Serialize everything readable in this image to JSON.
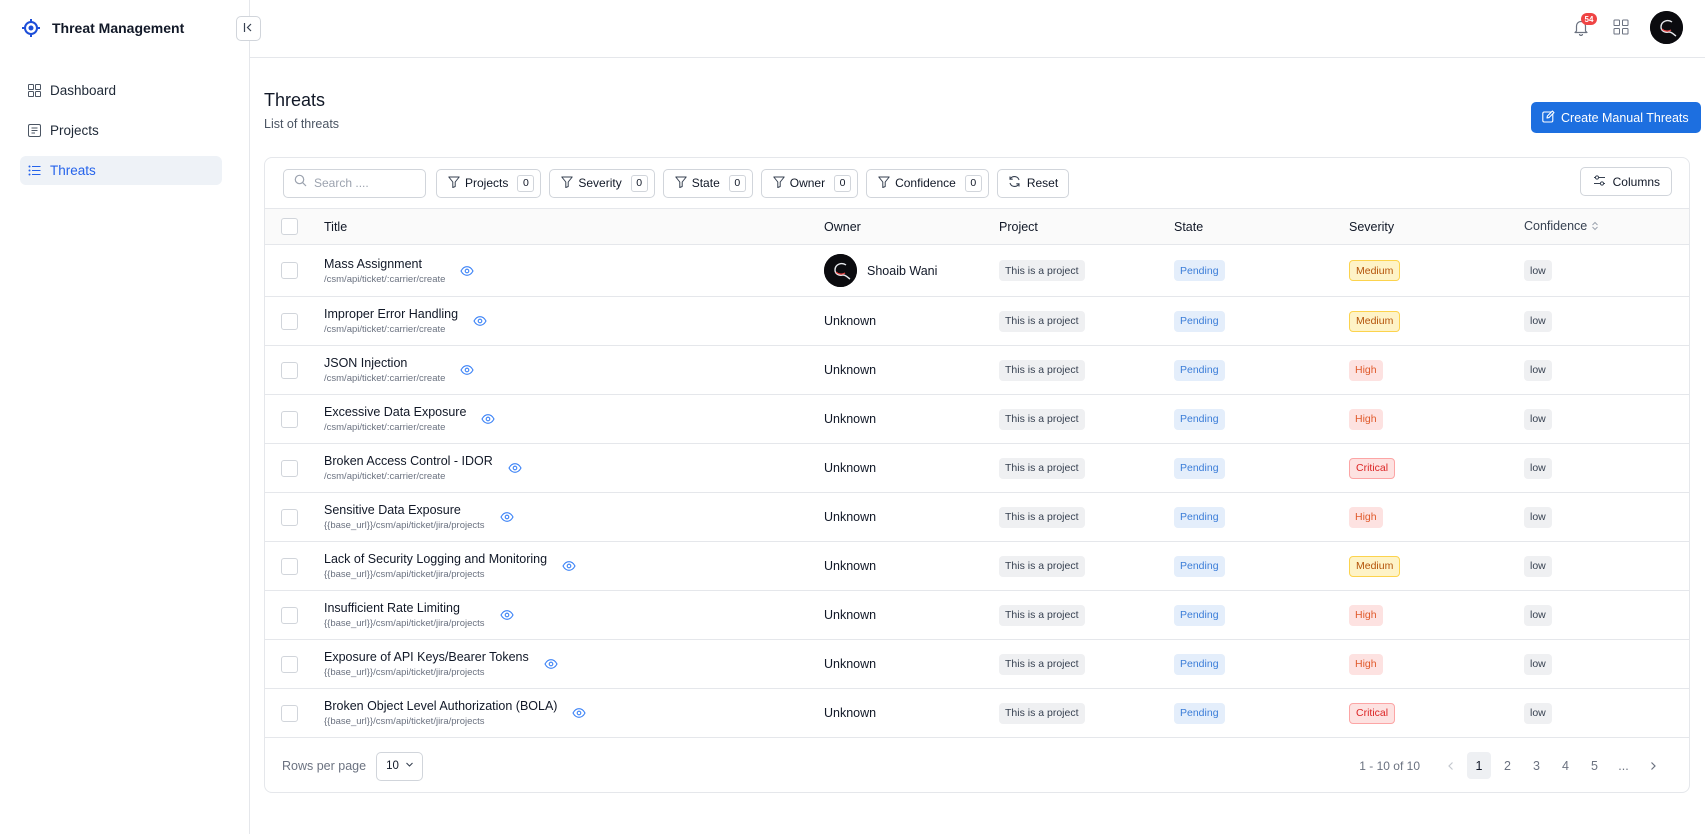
{
  "app": {
    "title": "Threat Management"
  },
  "sidebar": {
    "items": [
      {
        "label": "Dashboard",
        "icon": "dashboard-icon",
        "active": false
      },
      {
        "label": "Projects",
        "icon": "projects-icon",
        "active": false
      },
      {
        "label": "Threats",
        "icon": "list-icon",
        "active": true
      }
    ]
  },
  "topbar": {
    "notification_count": "54"
  },
  "page": {
    "title": "Threats",
    "subtitle": "List of threats",
    "create_label": "Create Manual Threats"
  },
  "toolbar": {
    "search_placeholder": "Search ....",
    "filters": [
      {
        "label": "Projects",
        "count": "0"
      },
      {
        "label": "Severity",
        "count": "0"
      },
      {
        "label": "State",
        "count": "0"
      },
      {
        "label": "Owner",
        "count": "0"
      },
      {
        "label": "Confidence",
        "count": "0"
      }
    ],
    "reset_label": "Reset",
    "columns_label": "Columns"
  },
  "table": {
    "headers": {
      "title": "Title",
      "owner": "Owner",
      "project": "Project",
      "state": "State",
      "severity": "Severity",
      "confidence": "Confidence"
    },
    "rows": [
      {
        "title": "Mass Assignment",
        "path": "/csm/api/ticket/:carrier/create",
        "owner": "Shoaib Wani",
        "owner_avatar": true,
        "project": "This is a project",
        "state": "Pending",
        "severity": "Medium",
        "confidence": "low"
      },
      {
        "title": "Improper Error Handling",
        "path": "/csm/api/ticket/:carrier/create",
        "owner": "Unknown",
        "owner_avatar": false,
        "project": "This is a project",
        "state": "Pending",
        "severity": "Medium",
        "confidence": "low"
      },
      {
        "title": "JSON Injection",
        "path": "/csm/api/ticket/:carrier/create",
        "owner": "Unknown",
        "owner_avatar": false,
        "project": "This is a project",
        "state": "Pending",
        "severity": "High",
        "confidence": "low"
      },
      {
        "title": "Excessive Data Exposure",
        "path": "/csm/api/ticket/:carrier/create",
        "owner": "Unknown",
        "owner_avatar": false,
        "project": "This is a project",
        "state": "Pending",
        "severity": "High",
        "confidence": "low"
      },
      {
        "title": "Broken Access Control - IDOR",
        "path": "/csm/api/ticket/:carrier/create",
        "owner": "Unknown",
        "owner_avatar": false,
        "project": "This is a project",
        "state": "Pending",
        "severity": "Critical",
        "confidence": "low"
      },
      {
        "title": "Sensitive Data Exposure",
        "path": "{{base_url}}/csm/api/ticket/jira/projects",
        "owner": "Unknown",
        "owner_avatar": false,
        "project": "This is a project",
        "state": "Pending",
        "severity": "High",
        "confidence": "low"
      },
      {
        "title": "Lack of Security Logging and Monitoring",
        "path": "{{base_url}}/csm/api/ticket/jira/projects",
        "owner": "Unknown",
        "owner_avatar": false,
        "project": "This is a project",
        "state": "Pending",
        "severity": "Medium",
        "confidence": "low"
      },
      {
        "title": "Insufficient Rate Limiting",
        "path": "{{base_url}}/csm/api/ticket/jira/projects",
        "owner": "Unknown",
        "owner_avatar": false,
        "project": "This is a project",
        "state": "Pending",
        "severity": "High",
        "confidence": "low"
      },
      {
        "title": "Exposure of API Keys/Bearer Tokens",
        "path": "{{base_url}}/csm/api/ticket/jira/projects",
        "owner": "Unknown",
        "owner_avatar": false,
        "project": "This is a project",
        "state": "Pending",
        "severity": "High",
        "confidence": "low"
      },
      {
        "title": "Broken Object Level Authorization (BOLA)",
        "path": "{{base_url}}/csm/api/ticket/jira/projects",
        "owner": "Unknown",
        "owner_avatar": false,
        "project": "This is a project",
        "state": "Pending",
        "severity": "Critical",
        "confidence": "low"
      }
    ]
  },
  "footer": {
    "rows_per_page_label": "Rows per page",
    "rows_per_page_value": "10",
    "range": "1 - 10 of 10",
    "pages": [
      "1",
      "2",
      "3",
      "4",
      "5"
    ],
    "ellipsis": "...",
    "current_page": "1"
  },
  "colors": {
    "accent": "#1d6fe0",
    "active_nav_bg": "#eef2f7"
  }
}
